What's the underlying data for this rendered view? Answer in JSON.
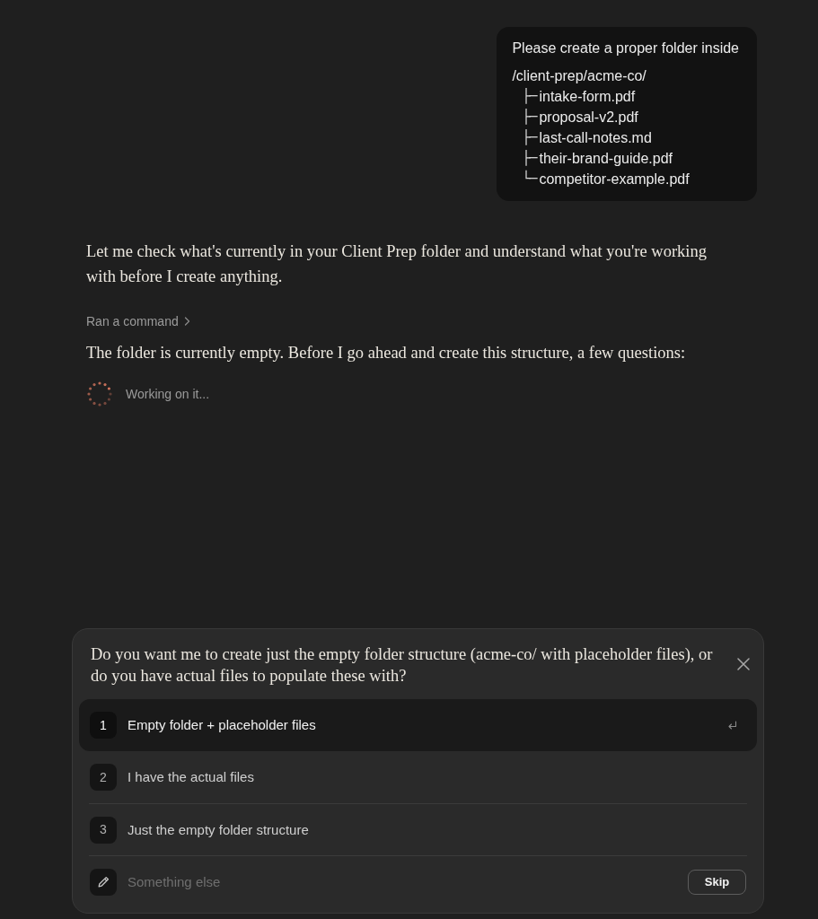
{
  "user_message": {
    "text": "Please create a proper folder inside",
    "tree": {
      "name": "/client-prep/acme-co/",
      "children": [
        {
          "branch": "├─",
          "name": "intake-form.pdf"
        },
        {
          "branch": "├─",
          "name": "proposal-v2.pdf"
        },
        {
          "branch": "├─",
          "name": "last-call-notes.md"
        },
        {
          "branch": "├─",
          "name": "their-brand-guide.pdf"
        },
        {
          "branch": "└─",
          "name": "competitor-example.pdf"
        }
      ]
    }
  },
  "assistant": [
    {
      "kind": "text",
      "text": "Let me check what's currently in your Client Prep folder and understand what you're working with before I create anything."
    },
    {
      "kind": "tool",
      "label": "Ran a command"
    },
    {
      "kind": "text",
      "text": "The folder is currently empty. Before I go ahead and create this structure, a few questions:"
    },
    {
      "kind": "status",
      "text": "Working on it..."
    }
  ],
  "question": {
    "text": "Do you want me to create just the empty folder structure (acme-co/ with placeholder files), or do you have actual files to populate these with?",
    "options": [
      {
        "number": "1",
        "label": "Empty folder + placeholder files",
        "selected": true
      },
      {
        "number": "2",
        "label": "I have the actual files",
        "selected": false
      },
      {
        "number": "3",
        "label": "Just the empty folder structure",
        "selected": false
      }
    ],
    "other": {
      "placeholder": "Something else"
    },
    "skip_button": "Skip"
  }
}
